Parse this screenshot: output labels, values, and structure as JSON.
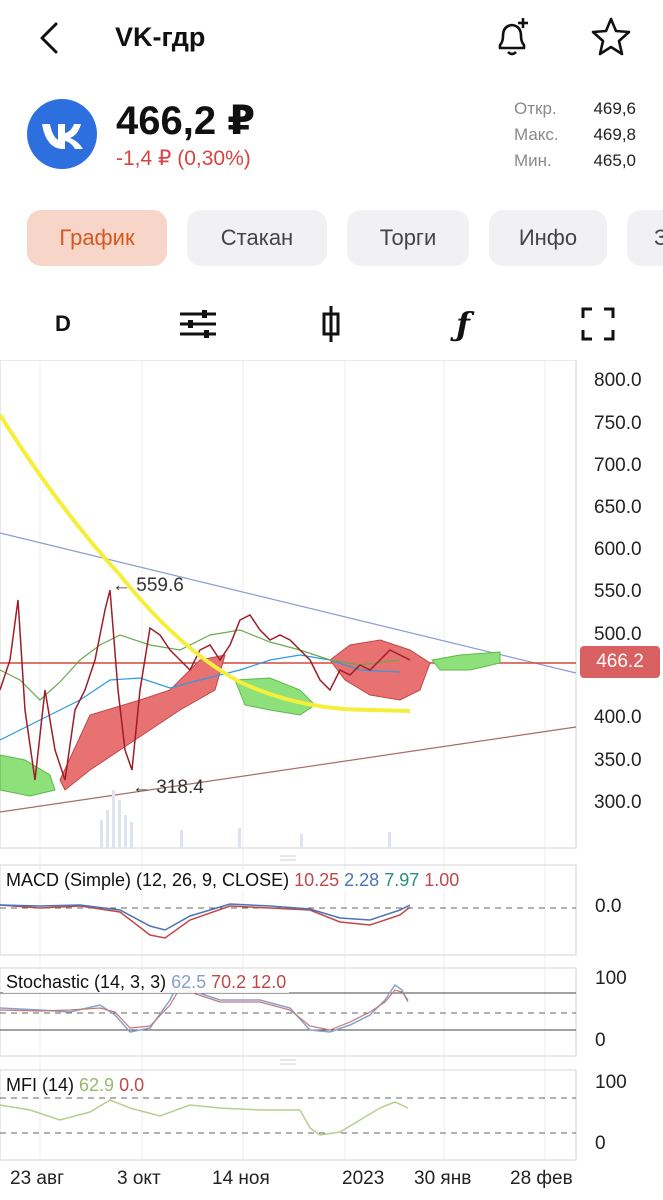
{
  "header": {
    "title": "VK-гдр"
  },
  "quote": {
    "price": "466,2 ₽",
    "change": "-1,4 ₽ (0,30%)",
    "stats": [
      {
        "label": "Откр.",
        "value": "469,6"
      },
      {
        "label": "Макс.",
        "value": "469,8"
      },
      {
        "label": "Мин.",
        "value": "465,0"
      }
    ]
  },
  "tabs": [
    {
      "label": "График",
      "active": true
    },
    {
      "label": "Стакан"
    },
    {
      "label": "Торги"
    },
    {
      "label": "Инфо"
    },
    {
      "label": "З"
    }
  ],
  "toolbar": {
    "interval": "D",
    "func": "ƒ"
  },
  "chart": {
    "y_ticks": [
      "800.0",
      "750.0",
      "700.0",
      "650.0",
      "600.0",
      "550.0",
      "500.0",
      "400.0",
      "350.0",
      "300.0"
    ],
    "current_price": "466.2",
    "annotations": {
      "high": "← 559.6",
      "low": "← 318.4"
    },
    "x_ticks": [
      "23 авг",
      "3 окт",
      "14 ноя",
      "2023",
      "30 янв",
      "28 фев"
    ],
    "macd": {
      "title": "MACD (Simple) (12, 26, 9, CLOSE)",
      "v1": "10.25",
      "v2": "2.28",
      "v3": "7.97",
      "v4": "1.00",
      "zero": "0.0"
    },
    "stochastic": {
      "title": "Stochastic (14, 3, 3)",
      "v1": "62.5",
      "v2": "70.2",
      "v3": "12.0",
      "top": "100",
      "bottom": "0"
    },
    "mfi": {
      "title": "MFI (14)",
      "v1": "62.9",
      "v2": "0.0",
      "top": "100",
      "bottom": "0"
    },
    "colors": {
      "bull_cloud": "#8ee07a",
      "bear_cloud": "#e87272",
      "sma": "#f5ee3a",
      "price_line": "#d24a3a"
    }
  }
}
